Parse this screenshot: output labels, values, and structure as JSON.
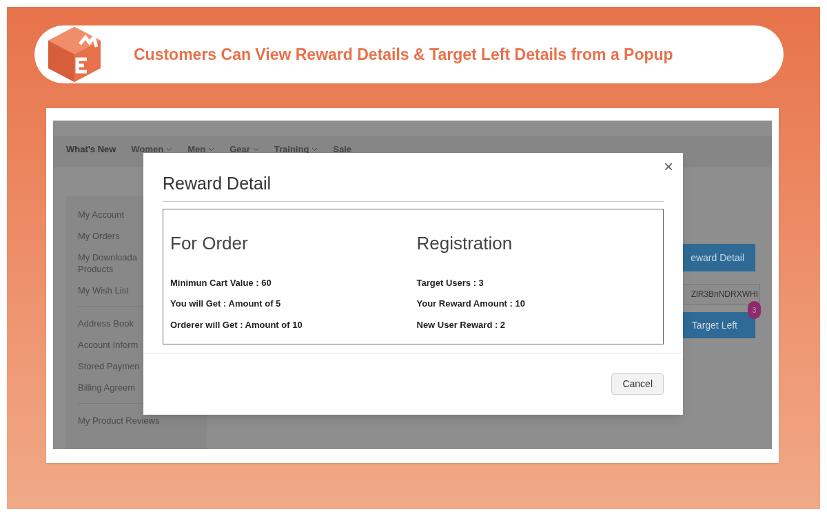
{
  "banner": {
    "title": "Customers Can View Reward Details & Target Left Details from a Popup"
  },
  "store": {
    "nav": [
      "What's New",
      "Women",
      "Men",
      "Gear",
      "Training",
      "Sale"
    ],
    "sidebar": {
      "groups": [
        [
          "My Account",
          "My Orders",
          "My Downloada\nProducts",
          "My Wish List"
        ],
        [
          "Address Book",
          "Account Inform",
          "Stored Paymen",
          "Billing Agreem"
        ],
        [
          "My Product Reviews"
        ]
      ]
    },
    "reward_button": "eward Detail",
    "code_field": {
      "value": "ZlR3BnNDRXWHI"
    },
    "target_button": {
      "label": "Target Left",
      "badge": "3"
    }
  },
  "modal": {
    "title": "Reward Detail",
    "close": "×",
    "columns": [
      {
        "heading": "For Order",
        "lines": [
          "Minimun Cart Value : 60",
          "You will Get : Amount of 5",
          "Orderer will Get : Amount of 10"
        ]
      },
      {
        "heading": "Registration",
        "lines": [
          "Target Users : 3",
          "Your Reward Amount : 10",
          "New User Reward : 2"
        ]
      }
    ],
    "buttons": [
      "Cancel"
    ]
  }
}
